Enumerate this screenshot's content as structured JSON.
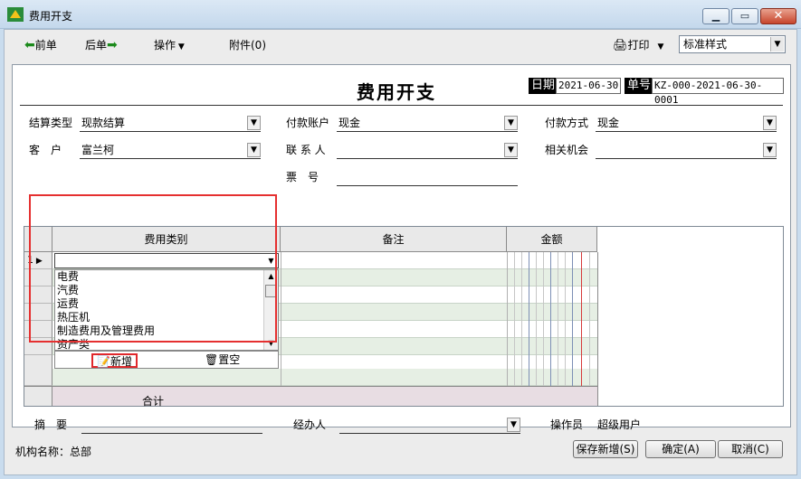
{
  "window": {
    "title": "费用开支"
  },
  "toolbar": {
    "prev": "前单",
    "next": "后单",
    "ops": "操作",
    "attach": "附件(0)",
    "print": "打印",
    "style": "标准样式"
  },
  "header": {
    "title": "费用开支",
    "date_label": "日期",
    "date_value": "2021-06-30",
    "no_label": "单号",
    "no_value": "KZ-000-2021-06-30-0001"
  },
  "form": {
    "settle_type_label": "结算类型",
    "settle_type_value": "现款结算",
    "pay_account_label": "付款账户",
    "pay_account_value": "现金",
    "pay_method_label": "付款方式",
    "pay_method_value": "现金",
    "customer_label": "客　户",
    "customer_value": "富兰柯",
    "contact_label": "联 系 人",
    "contact_value": "",
    "opportunity_label": "相关机会",
    "opportunity_value": "",
    "ticket_label": "票　号",
    "ticket_value": ""
  },
  "grid": {
    "col_category": "费用类别",
    "col_note": "备注",
    "col_amount": "金额",
    "row1_no": "1",
    "total_label": "合计"
  },
  "dropdown": {
    "options": [
      "电费",
      "汽费",
      "运费",
      "热压机",
      "制造费用及管理费用",
      "资产类"
    ],
    "new_label": "新增",
    "clear_label": "置空"
  },
  "footer_form": {
    "summary_label": "摘　要",
    "handler_label": "经办人",
    "operator_label": "操作员",
    "operator_value": "超级用户"
  },
  "bottom": {
    "org_label": "机构名称：总部",
    "save_new": "保存新增(S)",
    "ok": "确定(A)",
    "cancel": "取消(C)"
  }
}
